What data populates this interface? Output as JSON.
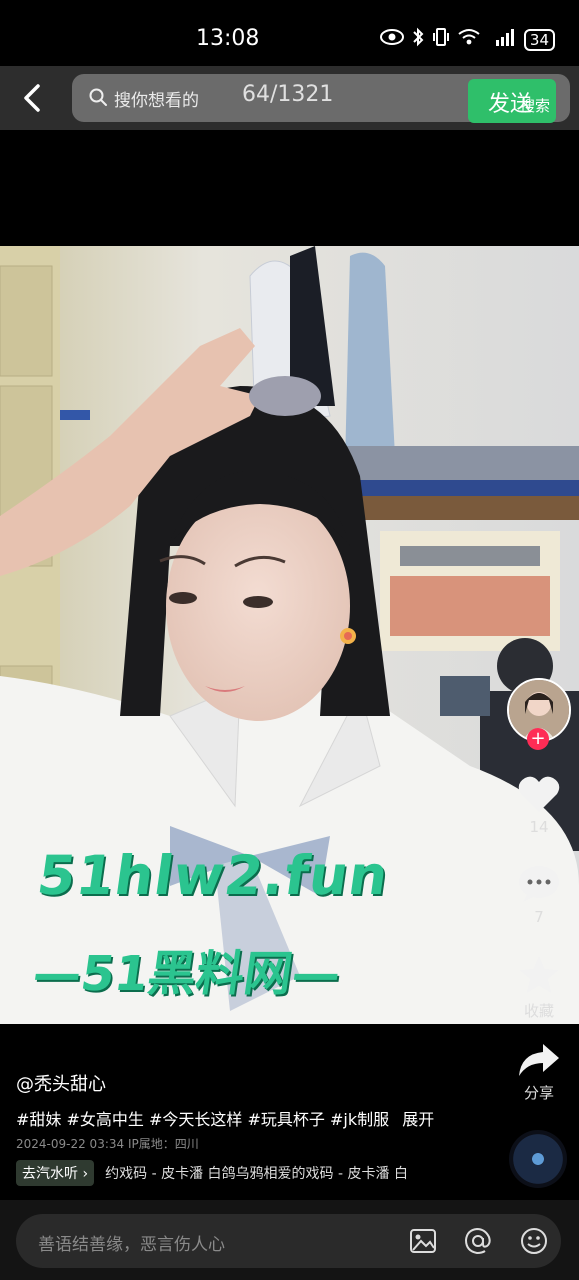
{
  "status": {
    "time": "13:08",
    "battery": "34"
  },
  "search": {
    "placeholder": "搜你想看的",
    "counter": "64/1321",
    "send_label": "发送",
    "search_label": "搜索"
  },
  "watermark": {
    "line1": "51hlw2.fun",
    "line2": "—51黑料网—"
  },
  "actions": {
    "like_count": "14",
    "comment_count": "7",
    "favorite_label": "收藏",
    "share_label": "分享"
  },
  "post": {
    "author": "@秃头甜心",
    "tags": "#甜妹 #女高中生 #今天长这样 #玩具杯子 #jk制服",
    "expand_label": "展开",
    "meta": "2024-09-22 03:34  IP属地：四川"
  },
  "music": {
    "chip_label": "去汽水听 ›",
    "text": "约戏码 - 皮卡潘    白鸽乌鸦相爱的戏码 - 皮卡潘    白"
  },
  "comment": {
    "placeholder": "善语结善缘，恶言伤人心"
  },
  "colors": {
    "accent_green": "#2fbf6a",
    "follow_red": "#fe2c55",
    "watermark": "#2bc48f"
  }
}
